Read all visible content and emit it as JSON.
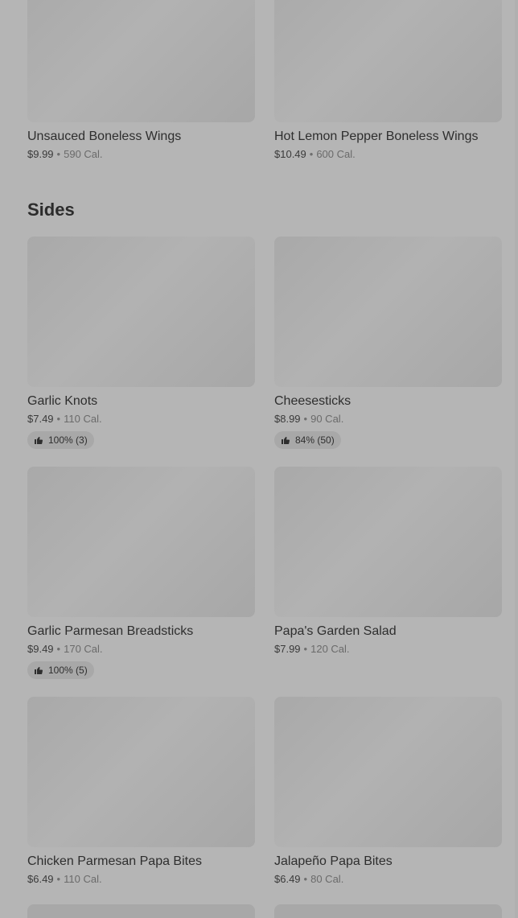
{
  "top_items": [
    {
      "name": "Unsauced Boneless Wings",
      "price": "$9.99",
      "sep": "•",
      "cal": "590 Cal."
    },
    {
      "name": "Hot Lemon Pepper Boneless Wings",
      "price": "$10.49",
      "sep": "•",
      "cal": "600 Cal."
    }
  ],
  "sides": {
    "title": "Sides",
    "items": [
      {
        "name": "Garlic Knots",
        "price": "$7.49",
        "sep": "•",
        "cal": "110 Cal.",
        "rating": "100% (3)"
      },
      {
        "name": "Cheesesticks",
        "price": "$8.99",
        "sep": "•",
        "cal": "90 Cal.",
        "rating": "84% (50)"
      },
      {
        "name": "Garlic Parmesan Breadsticks",
        "price": "$9.49",
        "sep": "•",
        "cal": "170 Cal.",
        "rating": "100% (5)"
      },
      {
        "name": "Papa's Garden Salad",
        "price": "$7.99",
        "sep": "•",
        "cal": "120 Cal."
      },
      {
        "name": "Chicken Parmesan Papa Bites",
        "price": "$6.49",
        "sep": "•",
        "cal": "110 Cal."
      },
      {
        "name": "Jalapeño Papa Bites",
        "price": "$6.49",
        "sep": "•",
        "cal": "80 Cal."
      }
    ]
  },
  "icons": {
    "thumbs_up": "thumbs-up-icon"
  },
  "colors": {
    "overlay_background": "#b5b5b5",
    "text_primary": "#2e2e2e",
    "text_secondary": "#6a6a6a"
  }
}
